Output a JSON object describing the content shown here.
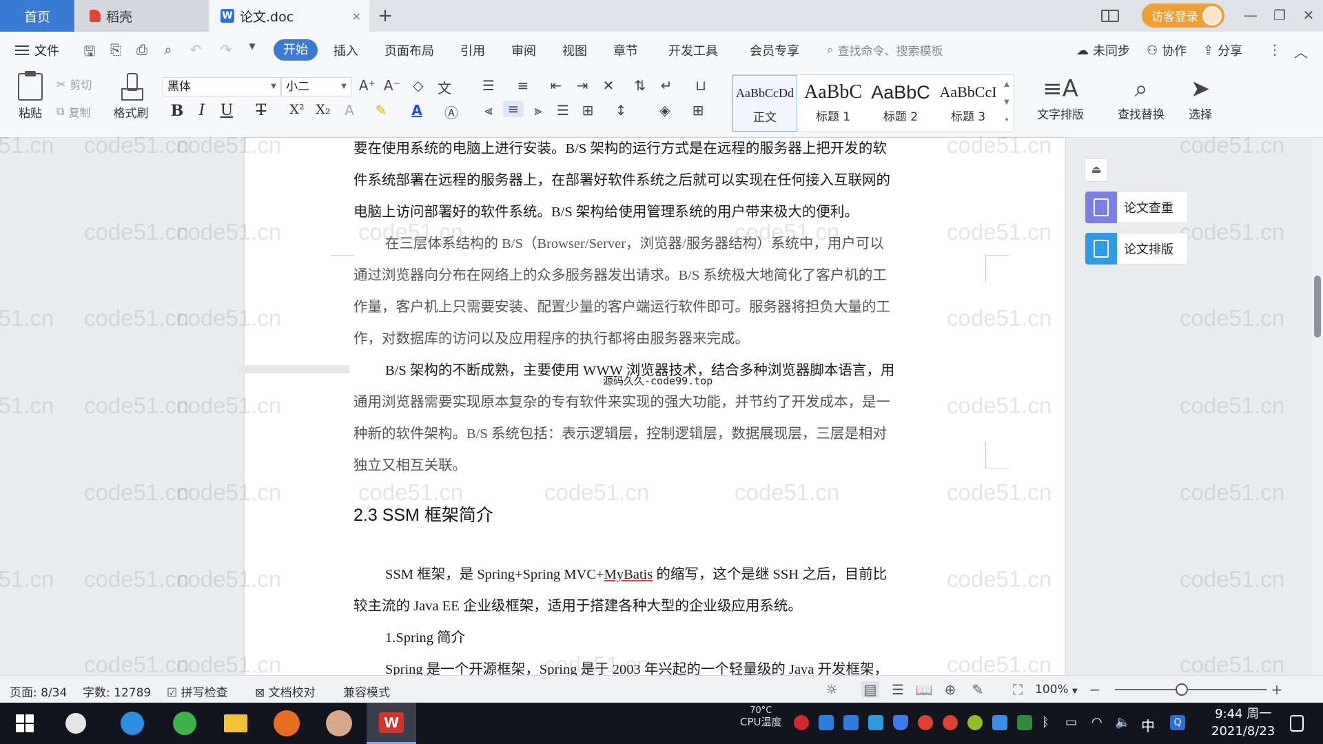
{
  "tabs": {
    "home": "首页",
    "daoke": "稻壳",
    "doc": "论文.doc",
    "doc_close": "×",
    "add": "+"
  },
  "window": {
    "login_label": "访客登录",
    "minimize": "—",
    "restore": "❐",
    "close": "✕"
  },
  "menu": {
    "file": "文件",
    "items": [
      "开始",
      "插入",
      "页面布局",
      "引用",
      "审阅",
      "视图",
      "章节",
      "开发工具",
      "会员专享"
    ],
    "search_placeholder": "查找命令、搜索模板",
    "sync": "未同步",
    "collab": "协作",
    "share": "分享"
  },
  "ribbon": {
    "paste": "粘贴",
    "cut": "剪切",
    "copy": "复制",
    "format_painter": "格式刷",
    "font_name": "黑体",
    "font_size": "小二",
    "bold": "B",
    "italic": "I",
    "underline": "U",
    "strike": "T",
    "superscript": "X²",
    "subscript": "X₂",
    "styles": [
      {
        "sample": "AaBbCcDd",
        "label": "正文"
      },
      {
        "sample": "AaBbC",
        "label": "标题 1"
      },
      {
        "sample": "AaBbC",
        "label": "标题 2"
      },
      {
        "sample": "AaBbCcI",
        "label": "标题 3"
      }
    ],
    "text_layout": "文字排版",
    "find_replace": "查找替换",
    "select": "选择"
  },
  "document": {
    "paragraphs": [
      "要在使用系统的电脑上进行安装。B/S 架构的运行方式是在远程的服务器上把开发的软",
      "件系统部署在远程的服务器上，在部署好软件系统之后就可以实现在任何接入互联网的",
      "电脑上访问部署好的软件系统。B/S 架构给使用管理系统的用户带来极大的便利。",
      "在三层体系结构的 B/S（Browser/Server，浏览器/服务器结构）系统中，用户可以",
      "通过浏览器向分布在网络上的众多服务器发出请求。B/S 系统极大地简化了客户机的工",
      "作量，客户机上只需要安装、配置少量的客户端运行软件即可。服务器将担负大量的工",
      "作，对数据库的访问以及应用程序的执行都将由服务器来完成。",
      "B/S 架构的不断成熟，主要使用 WWW 浏览器技术，结合多种浏览器脚本语言，用",
      "通用浏览器需要实现原本复杂的专有软件来实现的强大功能，并节约了开发成本，是一",
      "种新的软件架构。B/S 系统包括：表示逻辑层，控制逻辑层，数据展现层，三层是相对",
      "独立又相互关联。"
    ],
    "overlay_text": "源码久久-code99.top",
    "heading": "2.3 SSM 框架简介",
    "ssm_para_1a": "SSM 框架，是 Spring+Spring MVC+",
    "ssm_para_1b": "MyBatis",
    "ssm_para_1c": " 的缩写，这个是继 SSH 之后，目前比",
    "ssm_para_2": "较主流的 Java EE 企业级框架，适用于搭建各种大型的企业级应用系统。",
    "spring_heading": "1.Spring 简介",
    "spring_para": "Spring 是一个开源框架，Spring 是于 2003 年兴起的一个轻量级的 Java 开发框架，",
    "watermark": "code51.cn"
  },
  "side_panel": {
    "check": "论文查重",
    "layout": "论文排版",
    "check_color": "#7b7fe6",
    "layout_color": "#2f9ae6"
  },
  "status": {
    "page": "页面: 8/34",
    "words": "字数: 12789",
    "spell": "拼写检查",
    "proof": "文档校对",
    "compat": "兼容模式",
    "zoom": "100%"
  },
  "taskbar": {
    "temp_value": "70°C",
    "temp_label": "CPU温度",
    "ime": "中",
    "time": "9:44 周一",
    "date": "2021/8/23"
  },
  "colors": {
    "accent": "#3a7bd5",
    "login": "#f0a030"
  }
}
